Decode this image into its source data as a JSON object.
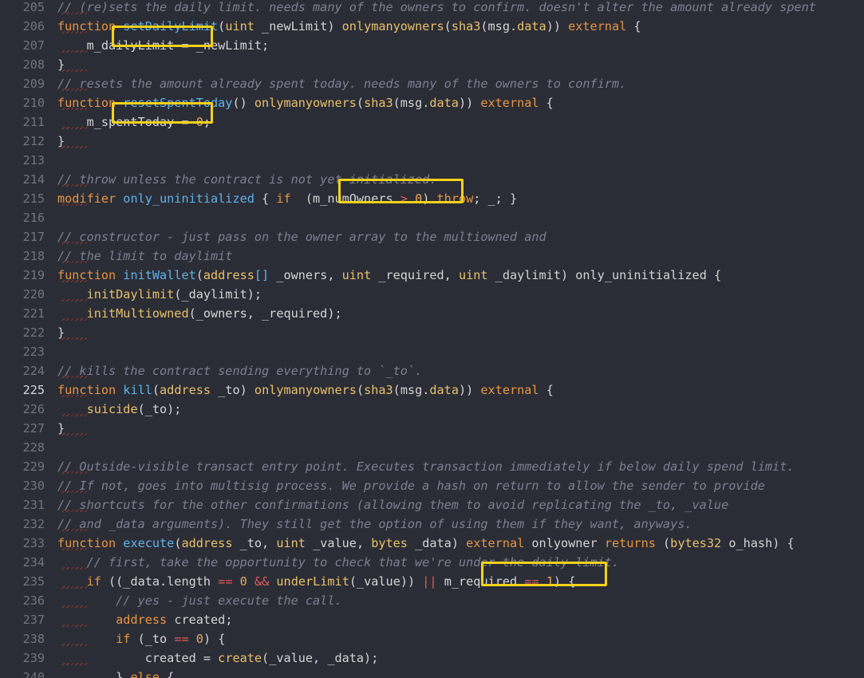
{
  "editor": {
    "active_line": "225",
    "lines": [
      {
        "n": "205",
        "tokens": [
          [
            "c",
            "// (re)sets the daily limit. needs many of the owners to confirm. doesn't alter the amount already spent"
          ]
        ]
      },
      {
        "n": "206",
        "tokens": [
          [
            "k",
            "function "
          ],
          [
            "fn",
            "setDailyLimit"
          ],
          [
            "id",
            "("
          ],
          [
            "kw2",
            "uint "
          ],
          [
            "id",
            "_newLimit) "
          ],
          [
            "kw2",
            "onlymanyowners"
          ],
          [
            "id",
            "("
          ],
          [
            "kw2",
            "sha3"
          ],
          [
            "id",
            "(msg."
          ],
          [
            "kw2",
            "data"
          ],
          [
            "id",
            ")) "
          ],
          [
            "k",
            "external"
          ],
          [
            "id",
            " {"
          ]
        ]
      },
      {
        "n": "207",
        "tokens": [
          [
            "id",
            "    m_dailyLimit = _newLimit;"
          ]
        ]
      },
      {
        "n": "208",
        "tokens": [
          [
            "id",
            "}"
          ]
        ]
      },
      {
        "n": "209",
        "tokens": [
          [
            "c",
            "// resets the amount already spent today. needs many of the owners to confirm."
          ]
        ]
      },
      {
        "n": "210",
        "tokens": [
          [
            "k",
            "function "
          ],
          [
            "fn",
            "resetSpentToday"
          ],
          [
            "id",
            "() "
          ],
          [
            "kw2",
            "onlymanyowners"
          ],
          [
            "id",
            "("
          ],
          [
            "kw2",
            "sha3"
          ],
          [
            "id",
            "(msg."
          ],
          [
            "kw2",
            "data"
          ],
          [
            "id",
            ")) "
          ],
          [
            "k",
            "external"
          ],
          [
            "id",
            " {"
          ]
        ]
      },
      {
        "n": "211",
        "tokens": [
          [
            "id",
            "    m_spentToday = "
          ],
          [
            "num",
            "0"
          ],
          [
            "id",
            ";"
          ]
        ]
      },
      {
        "n": "212",
        "tokens": [
          [
            "id",
            "}"
          ]
        ]
      },
      {
        "n": "213",
        "tokens": []
      },
      {
        "n": "214",
        "tokens": [
          [
            "c",
            "// throw unless the contract is not yet initialized."
          ]
        ]
      },
      {
        "n": "215",
        "tokens": [
          [
            "k",
            "modifier "
          ],
          [
            "fn",
            "only_uninitialized"
          ],
          [
            "id",
            " { "
          ],
          [
            "k",
            "if"
          ],
          [
            "id",
            "  (m_numOwners "
          ],
          [
            "op",
            "> "
          ],
          [
            "num",
            "0"
          ],
          [
            "id",
            ") "
          ],
          [
            "k",
            "throw"
          ],
          [
            "id",
            "; _; }"
          ]
        ]
      },
      {
        "n": "216",
        "tokens": []
      },
      {
        "n": "217",
        "tokens": [
          [
            "c",
            "// constructor - just pass on the owner array to the multiowned and"
          ]
        ]
      },
      {
        "n": "218",
        "tokens": [
          [
            "c",
            "// the limit to daylimit"
          ]
        ]
      },
      {
        "n": "219",
        "tokens": [
          [
            "k",
            "function "
          ],
          [
            "fn",
            "initWallet"
          ],
          [
            "id",
            "("
          ],
          [
            "kw2",
            "address"
          ],
          [
            "fn",
            "[]"
          ],
          [
            "id",
            " _owners, "
          ],
          [
            "kw2",
            "uint"
          ],
          [
            "id",
            " _required, "
          ],
          [
            "kw2",
            "uint"
          ],
          [
            "id",
            " _daylimit) only_uninitialized {"
          ]
        ]
      },
      {
        "n": "220",
        "tokens": [
          [
            "id",
            "    "
          ],
          [
            "kw2",
            "initDaylimit"
          ],
          [
            "id",
            "(_daylimit);"
          ]
        ]
      },
      {
        "n": "221",
        "tokens": [
          [
            "id",
            "    "
          ],
          [
            "kw2",
            "initMultiowned"
          ],
          [
            "id",
            "(_owners, _required);"
          ]
        ]
      },
      {
        "n": "222",
        "tokens": [
          [
            "id",
            "}"
          ]
        ]
      },
      {
        "n": "223",
        "tokens": []
      },
      {
        "n": "224",
        "tokens": [
          [
            "c",
            "// kills the contract sending everything to `_to`."
          ]
        ]
      },
      {
        "n": "225",
        "tokens": [
          [
            "k",
            "function "
          ],
          [
            "fn",
            "kill"
          ],
          [
            "id",
            "("
          ],
          [
            "kw2",
            "address"
          ],
          [
            "id",
            " _to) "
          ],
          [
            "kw2",
            "onlymanyowners"
          ],
          [
            "id",
            "("
          ],
          [
            "kw2",
            "sha3"
          ],
          [
            "id",
            "(msg."
          ],
          [
            "kw2",
            "data"
          ],
          [
            "id",
            ")) "
          ],
          [
            "k",
            "external"
          ],
          [
            "id",
            " {"
          ]
        ]
      },
      {
        "n": "226",
        "tokens": [
          [
            "id",
            "    "
          ],
          [
            "kw2",
            "suicide"
          ],
          [
            "id",
            "(_to);"
          ]
        ]
      },
      {
        "n": "227",
        "tokens": [
          [
            "id",
            "}"
          ]
        ]
      },
      {
        "n": "228",
        "tokens": []
      },
      {
        "n": "229",
        "tokens": [
          [
            "c",
            "// Outside-visible transact entry point. Executes transaction immediately if below daily spend limit."
          ]
        ]
      },
      {
        "n": "230",
        "tokens": [
          [
            "c",
            "// If not, goes into multisig process. We provide a hash on return to allow the sender to provide"
          ]
        ]
      },
      {
        "n": "231",
        "tokens": [
          [
            "c",
            "// shortcuts for the other confirmations (allowing them to avoid replicating the _to, _value"
          ]
        ]
      },
      {
        "n": "232",
        "tokens": [
          [
            "c",
            "// and _data arguments). They still get the option of using them if they want, anyways."
          ]
        ]
      },
      {
        "n": "233",
        "tokens": [
          [
            "k",
            "function "
          ],
          [
            "fn",
            "execute"
          ],
          [
            "id",
            "("
          ],
          [
            "kw2",
            "address"
          ],
          [
            "id",
            " _to, "
          ],
          [
            "kw2",
            "uint"
          ],
          [
            "id",
            " _value, "
          ],
          [
            "kw2",
            "bytes"
          ],
          [
            "id",
            " _data) "
          ],
          [
            "k",
            "external"
          ],
          [
            "id",
            " onlyowner "
          ],
          [
            "k",
            "returns"
          ],
          [
            "id",
            " ("
          ],
          [
            "kw2",
            "bytes32"
          ],
          [
            "id",
            " o_hash) {"
          ]
        ]
      },
      {
        "n": "234",
        "tokens": [
          [
            "id",
            "    "
          ],
          [
            "c",
            "// first, take the opportunity to check that we're under the daily limit."
          ]
        ]
      },
      {
        "n": "235",
        "tokens": [
          [
            "id",
            "    "
          ],
          [
            "k",
            "if"
          ],
          [
            "id",
            " ((_data.length "
          ],
          [
            "op",
            "=="
          ],
          [
            "id",
            " "
          ],
          [
            "num",
            "0"
          ],
          [
            "id",
            " "
          ],
          [
            "op",
            "&&"
          ],
          [
            "id",
            " "
          ],
          [
            "kw2",
            "underLimit"
          ],
          [
            "id",
            "(_value)) "
          ],
          [
            "op",
            "||"
          ],
          [
            "id",
            " m_required "
          ],
          [
            "op",
            "=="
          ],
          [
            "id",
            " "
          ],
          [
            "num",
            "1"
          ],
          [
            "id",
            ") {"
          ]
        ]
      },
      {
        "n": "236",
        "tokens": [
          [
            "id",
            "        "
          ],
          [
            "c",
            "// yes - just execute the call."
          ]
        ]
      },
      {
        "n": "237",
        "tokens": [
          [
            "id",
            "        "
          ],
          [
            "k",
            "address"
          ],
          [
            "id",
            " created;"
          ]
        ]
      },
      {
        "n": "238",
        "tokens": [
          [
            "id",
            "        "
          ],
          [
            "k",
            "if"
          ],
          [
            "id",
            " (_to "
          ],
          [
            "op",
            "=="
          ],
          [
            "id",
            " "
          ],
          [
            "num",
            "0"
          ],
          [
            "id",
            ") {"
          ]
        ]
      },
      {
        "n": "239",
        "tokens": [
          [
            "id",
            "            created = "
          ],
          [
            "kw2",
            "create"
          ],
          [
            "id",
            "(_value, _data);"
          ]
        ]
      },
      {
        "n": "240",
        "tokens": [
          [
            "id",
            "        } "
          ],
          [
            "k",
            "else"
          ],
          [
            "id",
            " {"
          ]
        ]
      }
    ]
  }
}
